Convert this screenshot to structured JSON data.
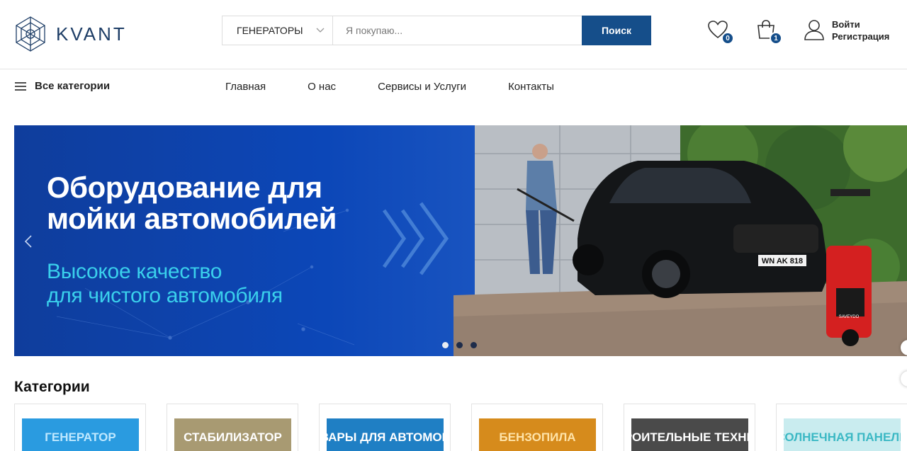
{
  "brand": {
    "name": "KVANT"
  },
  "search": {
    "category": "ГЕНЕРАТОРЫ",
    "placeholder": "Я покупаю...",
    "button": "Поиск"
  },
  "header": {
    "wishlist_count": "0",
    "cart_count": "1",
    "login": "Войти",
    "register": "Регистрация"
  },
  "nav": {
    "all_categories": "Все категории",
    "links": [
      "Главная",
      "О нас",
      "Сервисы и Услуги",
      "Контакты"
    ]
  },
  "banner": {
    "title_line1": "Оборудование для",
    "title_line2": "мойки автомобилей",
    "subtitle_line1": "Высокое качество",
    "subtitle_line2": "для чистого автомобиля",
    "plate": "WN AK 818",
    "pressure_washer_brand": "SAVEYDO",
    "slide_count": 3,
    "active_slide": 1
  },
  "categories": {
    "title": "Категории",
    "items": [
      {
        "label": "ГЕНЕРАТОР",
        "bg": "#2a9be0",
        "fg": "#bfe8ff"
      },
      {
        "label": "СТАБИЛИЗАТОР",
        "bg": "#a89a72",
        "fg": "#ffffff"
      },
      {
        "label": "ТОВАРЫ ДЛЯ АВТОМОЙКА",
        "bg": "#1f7fc4",
        "fg": "#ffffff"
      },
      {
        "label": "БЕНЗОПИЛА",
        "bg": "#d68b1c",
        "fg": "#ffe3a8"
      },
      {
        "label": "СТРОИТЕЛЬНЫЕ ТЕХНИКИ",
        "bg": "#4a4a4a",
        "fg": "#ffffff"
      },
      {
        "label": "СОЛНЕЧНАЯ ПАНЕЛЬ",
        "bg": "#c9ecef",
        "fg": "#3bb8c4"
      }
    ]
  },
  "colors": {
    "primary": "#154e8a",
    "accent": "#3ad0ec"
  }
}
